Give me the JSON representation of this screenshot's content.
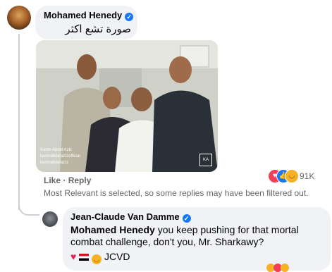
{
  "comment": {
    "author": "Mohamed Henedy",
    "text": "صورة تشع اكثر",
    "photo_watermark": [
      "Karim Abdel Aziz",
      "karimabdelazizofficial",
      "karimabdelaziz"
    ],
    "photo_logo": "KA",
    "actions": {
      "like": "Like",
      "separator": "·",
      "reply": "Reply"
    },
    "reactions": {
      "icons": [
        "love",
        "like",
        "haha"
      ],
      "count": "91K"
    },
    "filter_note": "Most Relevant is selected, so some replies may have been filtered out."
  },
  "reply": {
    "author": "Jean-Claude Van Damme",
    "mention": "Mohamed Henedy",
    "text": " you keep pushing for that mortal combat challenge, don't you, Mr. Sharkawy?",
    "signoff": "JCVD"
  },
  "colors": {
    "verified": "#1877f2",
    "bubble": "#f0f2f5",
    "meta": "#65676b"
  }
}
